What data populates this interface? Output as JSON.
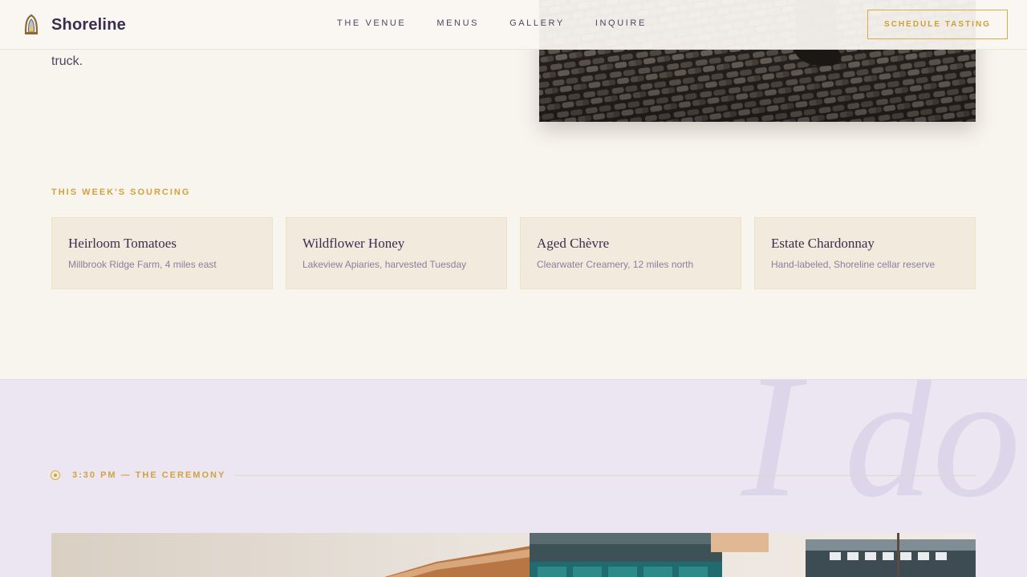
{
  "brand": {
    "name": "Shoreline"
  },
  "nav": {
    "items": [
      {
        "label": "THE VENUE"
      },
      {
        "label": "MENUS"
      },
      {
        "label": "GALLERY"
      },
      {
        "label": "INQUIRE"
      }
    ],
    "cta_label": "SCHEDULE TASTING"
  },
  "intro": {
    "text_fragment": "truck."
  },
  "sourcing": {
    "heading": "THIS WEEK'S SOURCING",
    "items": [
      {
        "title": "Heirloom Tomatoes",
        "detail": "Millbrook Ridge Farm, 4 miles east"
      },
      {
        "title": "Wildflower Honey",
        "detail": "Lakeview Apiaries, harvested Tuesday"
      },
      {
        "title": "Aged Chèvre",
        "detail": "Clearwater Creamery, 12 miles north"
      },
      {
        "title": "Estate Chardonnay",
        "detail": "Hand-labeled, Shoreline cellar reserve"
      }
    ]
  },
  "ceremony": {
    "watermark": "I do",
    "time_label": "3:30 PM — THE CEREMONY"
  },
  "colors": {
    "accent_gold": "#d1a23d",
    "text_plum": "#3a2d4e",
    "background_cream": "#f8f5ef",
    "ceremony_lavender": "#ebe6f2"
  }
}
